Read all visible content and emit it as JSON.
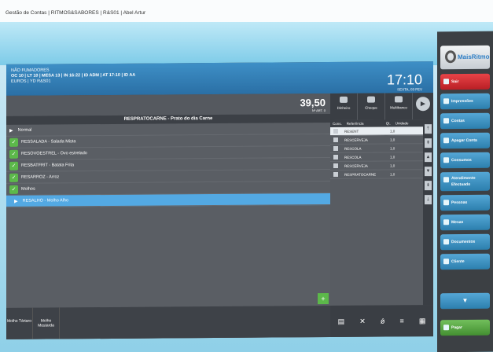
{
  "window": {
    "title": "Gestão de Contas | RITMOS&SABORES | R&S01 | Abel Artur"
  },
  "info": {
    "line1": "NÃO FUMADORES",
    "line2": "OC 10 | LT 10 | MESA 13 | IN 16:22 | ID ADM | AT 17:10 | ID AA",
    "line3": "EUROS | YD R&S01",
    "time": "17:10",
    "date": "SEXTA, 03 FEV"
  },
  "price": {
    "value": "39,50",
    "sub": "Nº ART. 0"
  },
  "payment": [
    "Dinheiro",
    "Cheque",
    "Multibanco"
  ],
  "panel": {
    "header": "RESPRATOCARNE - Prato do dia Carne",
    "rows": [
      {
        "label": "Normal",
        "type": "arrow"
      },
      {
        "label": "RESSALADA - Salada Mista",
        "type": "check"
      },
      {
        "label": "RESOVOESTREL - Ovo estrelado",
        "type": "check"
      },
      {
        "label": "RESBATFRIT - Batata Frita",
        "type": "check"
      },
      {
        "label": "RESARROZ - Arroz",
        "type": "check"
      },
      {
        "label": "Molhos",
        "type": "check"
      },
      {
        "label": "RESALHO - Molho Alho",
        "type": "selected"
      }
    ],
    "tabs": [
      "Molho Tártaro",
      "Molho Mostarda"
    ]
  },
  "order": {
    "headers": [
      "Cons.",
      "Referência",
      "Qt.",
      "Unidade"
    ],
    "rows": [
      {
        "name": "RESENT",
        "qty": "1,0",
        "selected": true
      },
      {
        "name": "RESCERVEJA",
        "qty": "1,0"
      },
      {
        "name": "RESCOLA",
        "qty": "1,0"
      },
      {
        "name": "RESCOLA",
        "qty": "1,0"
      },
      {
        "name": "RESCERVEJA",
        "qty": "1,0"
      },
      {
        "name": "RESPRATOCARNE",
        "qty": "1,0"
      }
    ]
  },
  "sidebar": {
    "logo": "MaisRitmo",
    "buttons": [
      "Sair",
      "Impressões",
      "Contas",
      "Apagar Conta",
      "Consumos",
      "Atendimento Efectuado",
      "Pessoas",
      "Mesas",
      "Documentos",
      "Cliente"
    ],
    "pay": "Pagar"
  }
}
